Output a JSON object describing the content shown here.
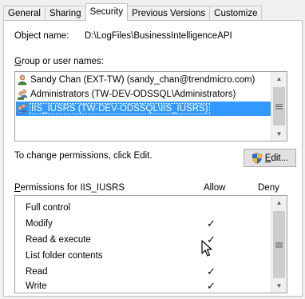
{
  "tabs": [
    "General",
    "Sharing",
    "Security",
    "Previous Versions",
    "Customize"
  ],
  "active_tab": "Security",
  "object": {
    "label": "Object name:",
    "value": "D:\\LogFiles\\BusinessIntelligenceAPI"
  },
  "groups": {
    "label_accel": "G",
    "label_rest": "roup or user names:",
    "items": [
      {
        "name": "Sandy Chan (EXT-TW) (sandy_chan@trendmicro.com)",
        "icon": "user-icon",
        "selected": false
      },
      {
        "name": "Administrators (TW-DEV-ODSSQL\\Administrators)",
        "icon": "group-icon",
        "selected": false
      },
      {
        "name": "IIS_IUSRS (TW-DEV-ODSSQL\\IIS_IUSRS)",
        "icon": "group-icon",
        "selected": true
      }
    ]
  },
  "change_text": "To change permissions, click Edit.",
  "edit_button": {
    "accel": "E",
    "rest": "dit..."
  },
  "permissions": {
    "header_accel": "P",
    "header_rest": "ermissions for IIS_IUSRS",
    "allow_label": "Allow",
    "deny_label": "Deny",
    "rows": [
      {
        "name": "Full control",
        "allow": false
      },
      {
        "name": "Modify",
        "allow": true
      },
      {
        "name": "Read & execute",
        "allow": true
      },
      {
        "name": "List folder contents",
        "allow": false
      },
      {
        "name": "Read",
        "allow": true
      },
      {
        "name": "Write",
        "allow": true
      }
    ],
    "check_glyph": "✓"
  },
  "colors": {
    "selection": "#3399ff",
    "panel": "#ffffff",
    "chrome": "#f0f0f0"
  }
}
